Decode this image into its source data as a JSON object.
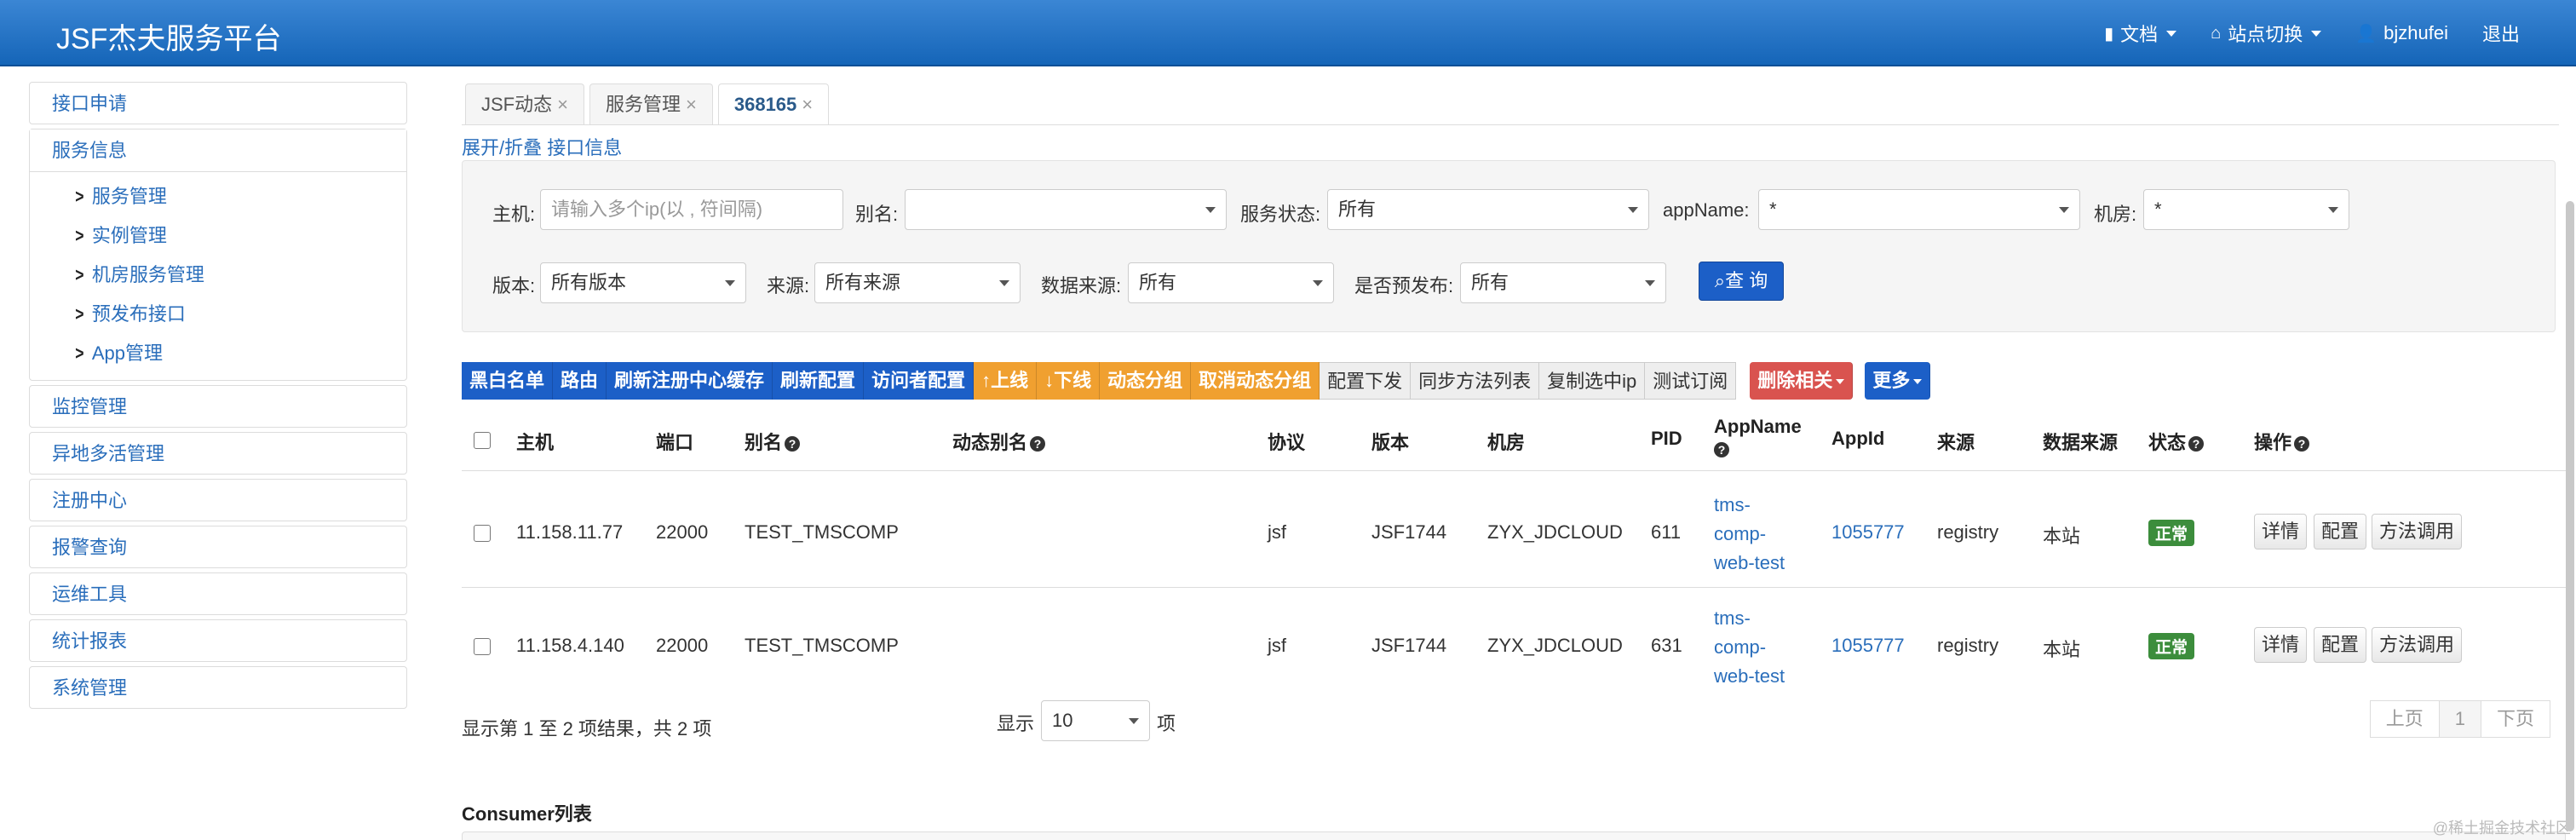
{
  "brand": "JSF杰夫服务平台",
  "nav": {
    "docs": "文档",
    "switch_site": "站点切换",
    "user": "bjzhufei",
    "logout": "退出"
  },
  "sidebar": {
    "items": [
      {
        "label": "接口申请"
      },
      {
        "label": "服务信息"
      },
      {
        "label": "监控管理"
      },
      {
        "label": "异地多活管理"
      },
      {
        "label": "注册中心"
      },
      {
        "label": "报警查询"
      },
      {
        "label": "运维工具"
      },
      {
        "label": "统计报表"
      },
      {
        "label": "系统管理"
      }
    ],
    "sub_items": [
      {
        "label": "服务管理"
      },
      {
        "label": "实例管理"
      },
      {
        "label": "机房服务管理"
      },
      {
        "label": "预发布接口"
      },
      {
        "label": "App管理"
      }
    ]
  },
  "tabs": [
    {
      "label": "JSF动态",
      "close": "×"
    },
    {
      "label": "服务管理",
      "close": "×"
    },
    {
      "label": "368165",
      "close": "×"
    }
  ],
  "toggle_link": "展开/折叠 接口信息",
  "filter": {
    "host_label": "主机:",
    "host_placeholder": "请输入多个ip(以 , 符间隔)",
    "alias_label": "别名:",
    "alias_value": "",
    "status_label": "服务状态:",
    "status_value": "所有",
    "appname_label": "appName:",
    "appname_value": "*",
    "room_label": "机房:",
    "room_value": "*",
    "version_label": "版本:",
    "version_value": "所有版本",
    "source_label": "来源:",
    "source_value": "所有来源",
    "datasource_label": "数据来源:",
    "datasource_value": "所有",
    "prerelease_label": "是否预发布:",
    "prerelease_value": "所有",
    "query_button": "查 询"
  },
  "toolbar": {
    "blue": [
      "黑白名单",
      "路由",
      "刷新注册中心缓存",
      "刷新配置",
      "访问者配置"
    ],
    "online": "上线",
    "offline": "下线",
    "orange": [
      "动态分组",
      "取消动态分组"
    ],
    "gray": [
      "配置下发",
      "同步方法列表",
      "复制选中ip",
      "测试订阅"
    ],
    "delete_related": "删除相关",
    "more": "更多"
  },
  "table": {
    "headers": {
      "host": "主机",
      "port": "端口",
      "alias": "别名",
      "dyn_alias": "动态别名",
      "protocol": "协议",
      "version": "版本",
      "room": "机房",
      "pid": "PID",
      "appname": "AppName",
      "appid": "AppId",
      "source": "来源",
      "datasource": "数据来源",
      "status": "状态",
      "ops": "操作"
    },
    "rows": [
      {
        "host": "11.158.11.77",
        "port": "22000",
        "alias": "TEST_TMSCOMP",
        "dyn_alias": "",
        "protocol": "jsf",
        "version": "JSF1744",
        "room": "ZYX_JDCLOUD",
        "pid": "611",
        "appname": [
          "tms-",
          "comp-",
          "web-test"
        ],
        "appid": "1055777",
        "source": "registry",
        "datasource": "本站",
        "status": "正常"
      },
      {
        "host": "11.158.4.140",
        "port": "22000",
        "alias": "TEST_TMSCOMP",
        "dyn_alias": "",
        "protocol": "jsf",
        "version": "JSF1744",
        "room": "ZYX_JDCLOUD",
        "pid": "631",
        "appname": [
          "tms-",
          "comp-",
          "web-test"
        ],
        "appid": "1055777",
        "source": "registry",
        "datasource": "本站",
        "status": "正常"
      }
    ],
    "row_actions": [
      "详情",
      "配置",
      "方法调用"
    ]
  },
  "summary": "显示第 1 至 2 项结果，共 2 项",
  "page_size": {
    "prefix": "显示",
    "value": "10",
    "suffix": "项"
  },
  "pager": {
    "prev": "上页",
    "current": "1",
    "next": "下页"
  },
  "consumer_title": "Consumer列表",
  "watermark": "@稀土掘金技术社区"
}
